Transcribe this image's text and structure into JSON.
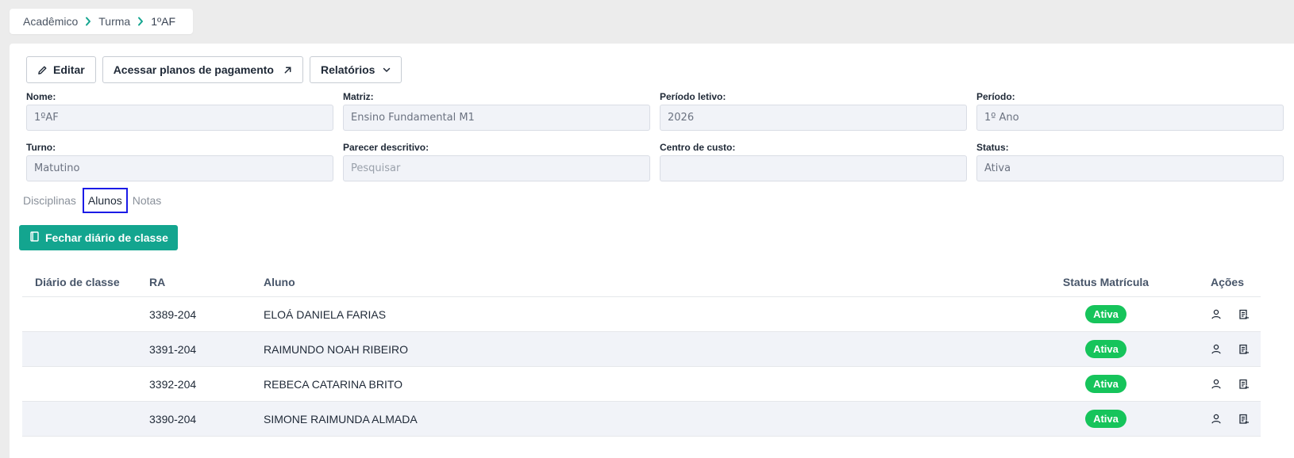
{
  "breadcrumb": {
    "items": [
      "Acadêmico",
      "Turma",
      "1ºAF"
    ]
  },
  "toolbar": {
    "edit_label": "Editar",
    "payment_plans_label": "Acessar planos de pagamento",
    "reports_label": "Relatórios"
  },
  "form": {
    "fields": [
      {
        "label": "Nome:",
        "value": "1ºAF"
      },
      {
        "label": "Matriz:",
        "value": "Ensino Fundamental M1"
      },
      {
        "label": "Período letivo:",
        "value": "2026"
      },
      {
        "label": "Período:",
        "value": "1º Ano"
      },
      {
        "label": "Turno:",
        "value": "Matutino"
      },
      {
        "label": "Parecer descritivo:",
        "placeholder": "Pesquisar",
        "value": ""
      },
      {
        "label": "Centro de custo:",
        "value": ""
      },
      {
        "label": "Status:",
        "value": "Ativa"
      }
    ]
  },
  "tabs": [
    {
      "label": "Disciplinas",
      "active": false
    },
    {
      "label": "Alunos",
      "active": true
    },
    {
      "label": "Notas",
      "active": false
    }
  ],
  "actions": {
    "close_diary_label": "Fechar diário de classe"
  },
  "table": {
    "headers": {
      "diario": "Diário de classe",
      "ra": "RA",
      "aluno": "Aluno",
      "status": "Status Matrícula",
      "acoes": "Ações"
    },
    "rows": [
      {
        "diario": "",
        "ra": "3389-204",
        "aluno": "ELOÁ DANIELA FARIAS",
        "status": "Ativa"
      },
      {
        "diario": "",
        "ra": "3391-204",
        "aluno": "RAIMUNDO NOAH RIBEIRO",
        "status": "Ativa"
      },
      {
        "diario": "",
        "ra": "3392-204",
        "aluno": "REBECA CATARINA BRITO",
        "status": "Ativa"
      },
      {
        "diario": "",
        "ra": "3390-204",
        "aluno": "SIMONE RAIMUNDA ALMADA",
        "status": "Ativa"
      }
    ]
  },
  "colors": {
    "accent": "#13a58f",
    "status_active": "#16c45b",
    "active_tab_outline": "#1b1be6"
  }
}
